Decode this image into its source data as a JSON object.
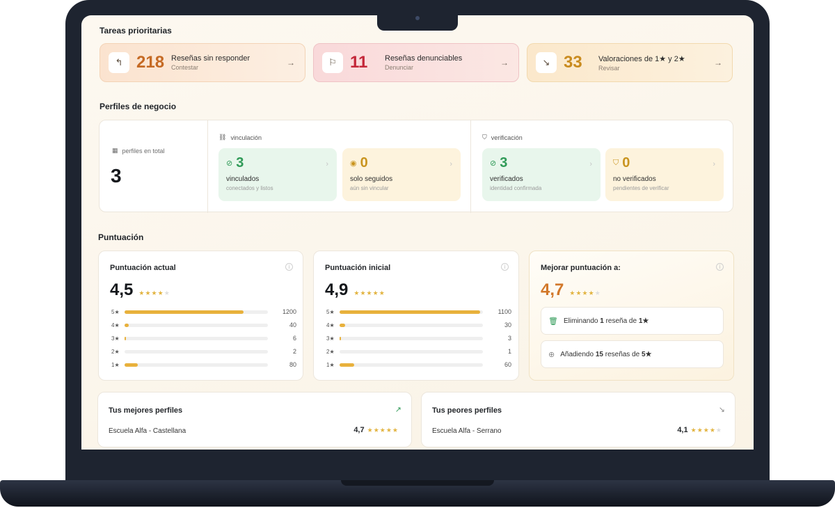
{
  "colors": {
    "accent_orange": "#d2782a",
    "red": "#c4283a",
    "gold": "#e8b13c",
    "green": "#2f9a57"
  },
  "priority": {
    "title": "Tareas prioritarias",
    "tasks": [
      {
        "icon": "reply-icon",
        "count": "218",
        "label": "Reseñas sin responder",
        "sub": "Contestar"
      },
      {
        "icon": "flag-icon",
        "count": "11",
        "label": "Reseñas denunciables",
        "sub": "Denunciar"
      },
      {
        "icon": "trend-down-icon",
        "count": "33",
        "label": "Valoraciones de 1★ y 2★",
        "sub": "Revisar"
      }
    ]
  },
  "profiles": {
    "title": "Perfiles de negocio",
    "total_label": "perfiles en total",
    "total": "3",
    "link_group": {
      "title": "vinculación",
      "cards": [
        {
          "value": "3",
          "label": "vinculados",
          "sub": "conectados y listos"
        },
        {
          "value": "0",
          "label": "solo seguidos",
          "sub": "aún sin vincular"
        }
      ]
    },
    "verify_group": {
      "title": "verificación",
      "cards": [
        {
          "value": "3",
          "label": "verificados",
          "sub": "identidad confirmada"
        },
        {
          "value": "0",
          "label": "no verificados",
          "sub": "pendientes de verificar"
        }
      ]
    }
  },
  "scores": {
    "title": "Puntuación",
    "current": {
      "title": "Puntuación actual",
      "value": "4,5",
      "stars": 4,
      "rows": [
        {
          "label": "5★",
          "count": "1200",
          "fill": 0.83
        },
        {
          "label": "4★",
          "count": "40",
          "fill": 0.03
        },
        {
          "label": "3★",
          "count": "6",
          "fill": 0.01
        },
        {
          "label": "2★",
          "count": "2",
          "fill": 0.0
        },
        {
          "label": "1★",
          "count": "80",
          "fill": 0.09
        }
      ]
    },
    "initial": {
      "title": "Puntuación inicial",
      "value": "4,9",
      "stars": 5,
      "rows": [
        {
          "label": "5★",
          "count": "1100",
          "fill": 0.98
        },
        {
          "label": "4★",
          "count": "30",
          "fill": 0.04
        },
        {
          "label": "3★",
          "count": "3",
          "fill": 0.01
        },
        {
          "label": "2★",
          "count": "1",
          "fill": 0.0
        },
        {
          "label": "1★",
          "count": "60",
          "fill": 0.1
        }
      ]
    },
    "improve": {
      "title": "Mejorar puntuación a:",
      "value": "4,7",
      "stars": 4,
      "remove": {
        "prefix": "Eliminando",
        "count": "1",
        "suffix": "reseña de",
        "stars": "1★"
      },
      "add": {
        "prefix": "Añadiendo",
        "count": "15",
        "suffix": "reseñas de",
        "stars": "5★"
      }
    }
  },
  "best": {
    "title": "Tus mejores perfiles",
    "name": "Escuela Alfa - Castellana",
    "value": "4,7",
    "stars": 5
  },
  "worst": {
    "title": "Tus peores perfiles",
    "name": "Escuela Alfa - Serrano",
    "value": "4,1",
    "stars": 4
  }
}
